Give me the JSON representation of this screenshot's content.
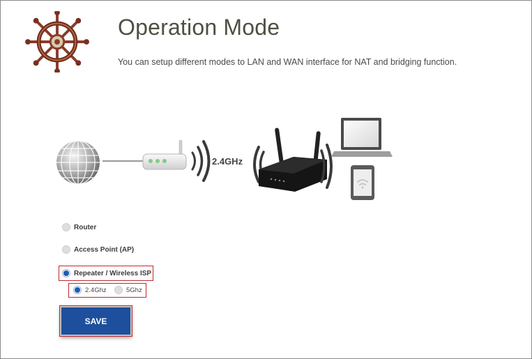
{
  "header": {
    "title": "Operation Mode",
    "subtitle": "You can setup different modes to LAN and WAN interface for NAT and bridging function."
  },
  "diagram": {
    "band_label": "2.4GHz",
    "icons": [
      "globe-icon",
      "modem-icon",
      "wifi-signal-icon",
      "router-icon",
      "laptop-icon",
      "tablet-icon"
    ]
  },
  "modes": {
    "items": [
      {
        "label": "Router",
        "selected": false
      },
      {
        "label": "Access Point (AP)",
        "selected": false
      },
      {
        "label": "Repeater / Wireless ISP",
        "selected": true
      }
    ],
    "bands": [
      {
        "label": "2.4Ghz",
        "selected": true
      },
      {
        "label": "5Ghz",
        "selected": false
      }
    ]
  },
  "actions": {
    "save_label": "SAVE"
  },
  "colors": {
    "accent": "#1d4f9c",
    "highlight_border": "#c0282d",
    "title": "#4f4f42"
  }
}
